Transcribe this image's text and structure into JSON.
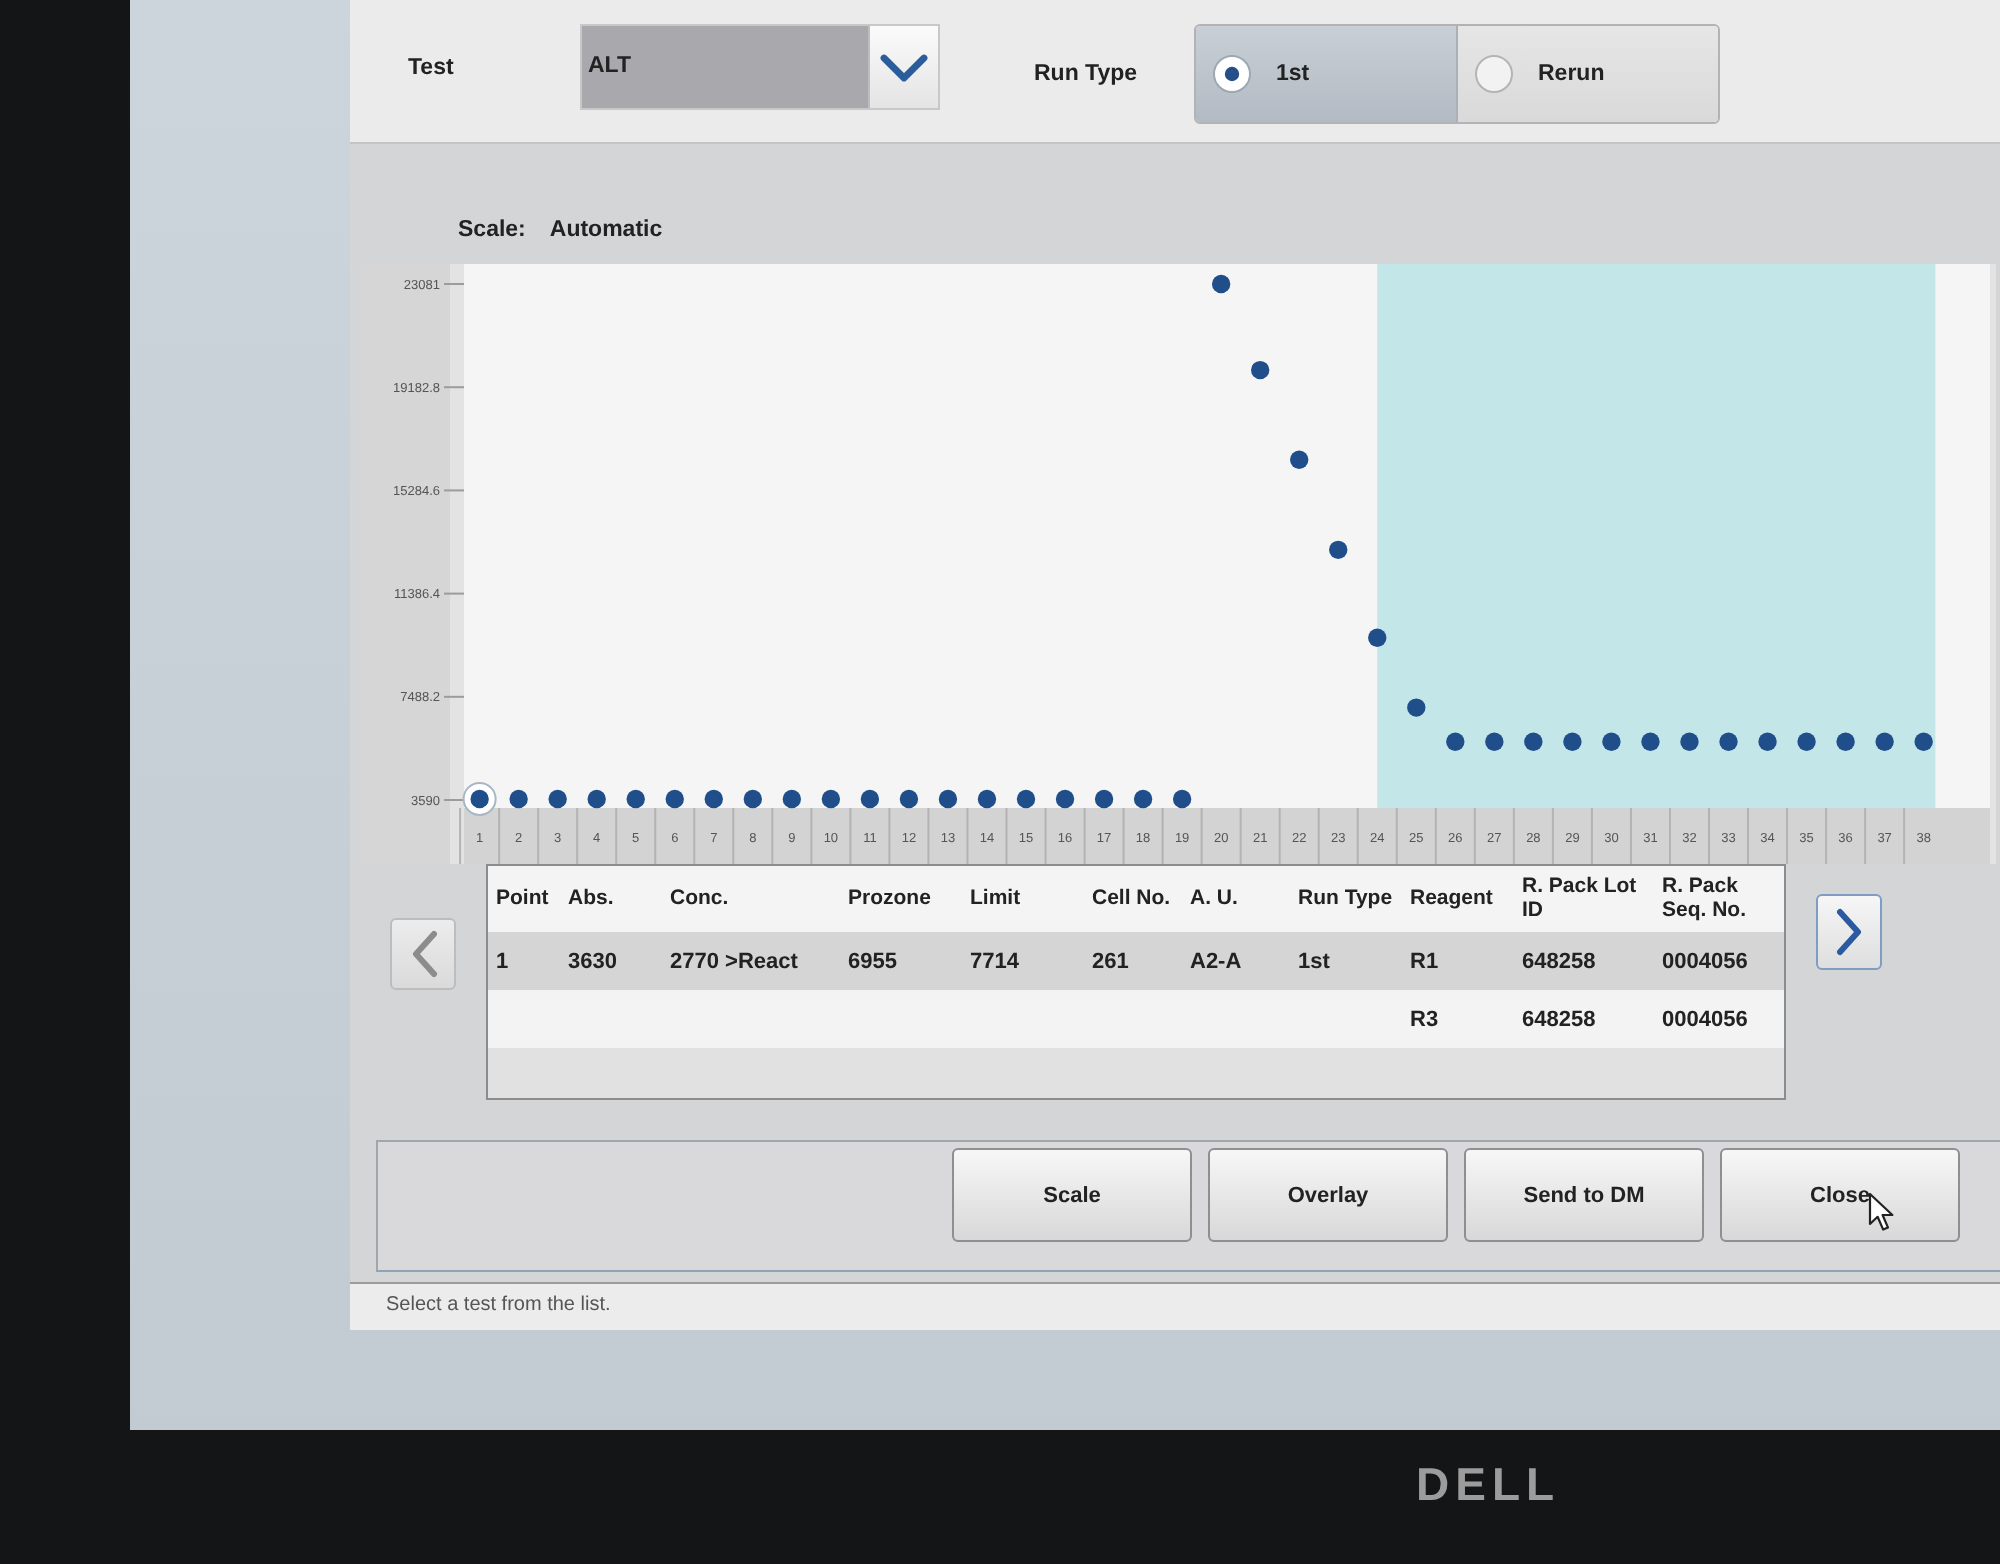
{
  "header": {
    "test_label": "Test",
    "test_select": {
      "value": "ALT"
    },
    "run_type_label": "Run Type",
    "run_type_options": [
      {
        "label": "1st",
        "selected": true
      },
      {
        "label": "Rerun",
        "selected": false
      }
    ]
  },
  "scale": {
    "label": "Scale:",
    "value": "Automatic"
  },
  "chart": {
    "chart_data": {
      "type": "scatter",
      "x": [
        1,
        2,
        3,
        4,
        5,
        6,
        7,
        8,
        9,
        10,
        11,
        12,
        13,
        14,
        15,
        16,
        17,
        18,
        19,
        20,
        21,
        22,
        23,
        24,
        25,
        26,
        27,
        28,
        29,
        30,
        31,
        32,
        33,
        34,
        35,
        36,
        37,
        38
      ],
      "series": [
        {
          "color": "#1f4e8a",
          "values": [
            3630,
            3630,
            3630,
            3630,
            3630,
            3630,
            3630,
            3630,
            3630,
            3630,
            3630,
            3630,
            3630,
            3630,
            3630,
            3630,
            3630,
            3630,
            3630,
            23081,
            19830,
            16440,
            13040,
            9720,
            7080,
            5790,
            5790,
            5790,
            5790,
            5790,
            5790,
            5790,
            5790,
            5790,
            5790,
            5790,
            5790,
            5790
          ]
        }
      ],
      "xlim": [
        0.6,
        39.7
      ],
      "ylim": [
        3288,
        23837
      ],
      "xticks": [
        1,
        2,
        3,
        4,
        5,
        6,
        7,
        8,
        9,
        10,
        11,
        12,
        13,
        14,
        15,
        16,
        17,
        18,
        19,
        20,
        21,
        22,
        23,
        24,
        25,
        26,
        27,
        28,
        29,
        30,
        31,
        32,
        33,
        34,
        35,
        36,
        37,
        38
      ],
      "yticks": [
        3590,
        7488.2,
        11386.4,
        15284.6,
        19182.8,
        23081
      ],
      "bands": [
        {
          "axis": "x",
          "from": 24,
          "to": 38.3
        }
      ]
    }
  },
  "pager": [
    {
      "kind": "previous",
      "disabled": true
    },
    {
      "kind": "next",
      "disabled": false
    }
  ],
  "table": {
    "columns": [
      "Point",
      "Abs.",
      "Conc.",
      "Prozone",
      "Limit",
      "Cell No.",
      "A. U.",
      "Run Type",
      "Reagent",
      "R. Pack Lot ID",
      "R. Pack Seq. No."
    ],
    "rows": [
      {
        "selected": true,
        "cells": [
          "1",
          "3630",
          "2770 >React",
          "6955",
          "7714",
          "261",
          "A2-A",
          "1st",
          "R1",
          "648258",
          "0004056"
        ]
      },
      {
        "selected": false,
        "cells": [
          null,
          null,
          null,
          null,
          null,
          null,
          null,
          null,
          "R3",
          "648258",
          "0004056"
        ]
      }
    ]
  },
  "buttons": [
    "Scale",
    "Overlay",
    "Send to DM",
    "Close"
  ],
  "status_bar": "Select a test from the list.",
  "monitor": {
    "logo": "DELL"
  }
}
